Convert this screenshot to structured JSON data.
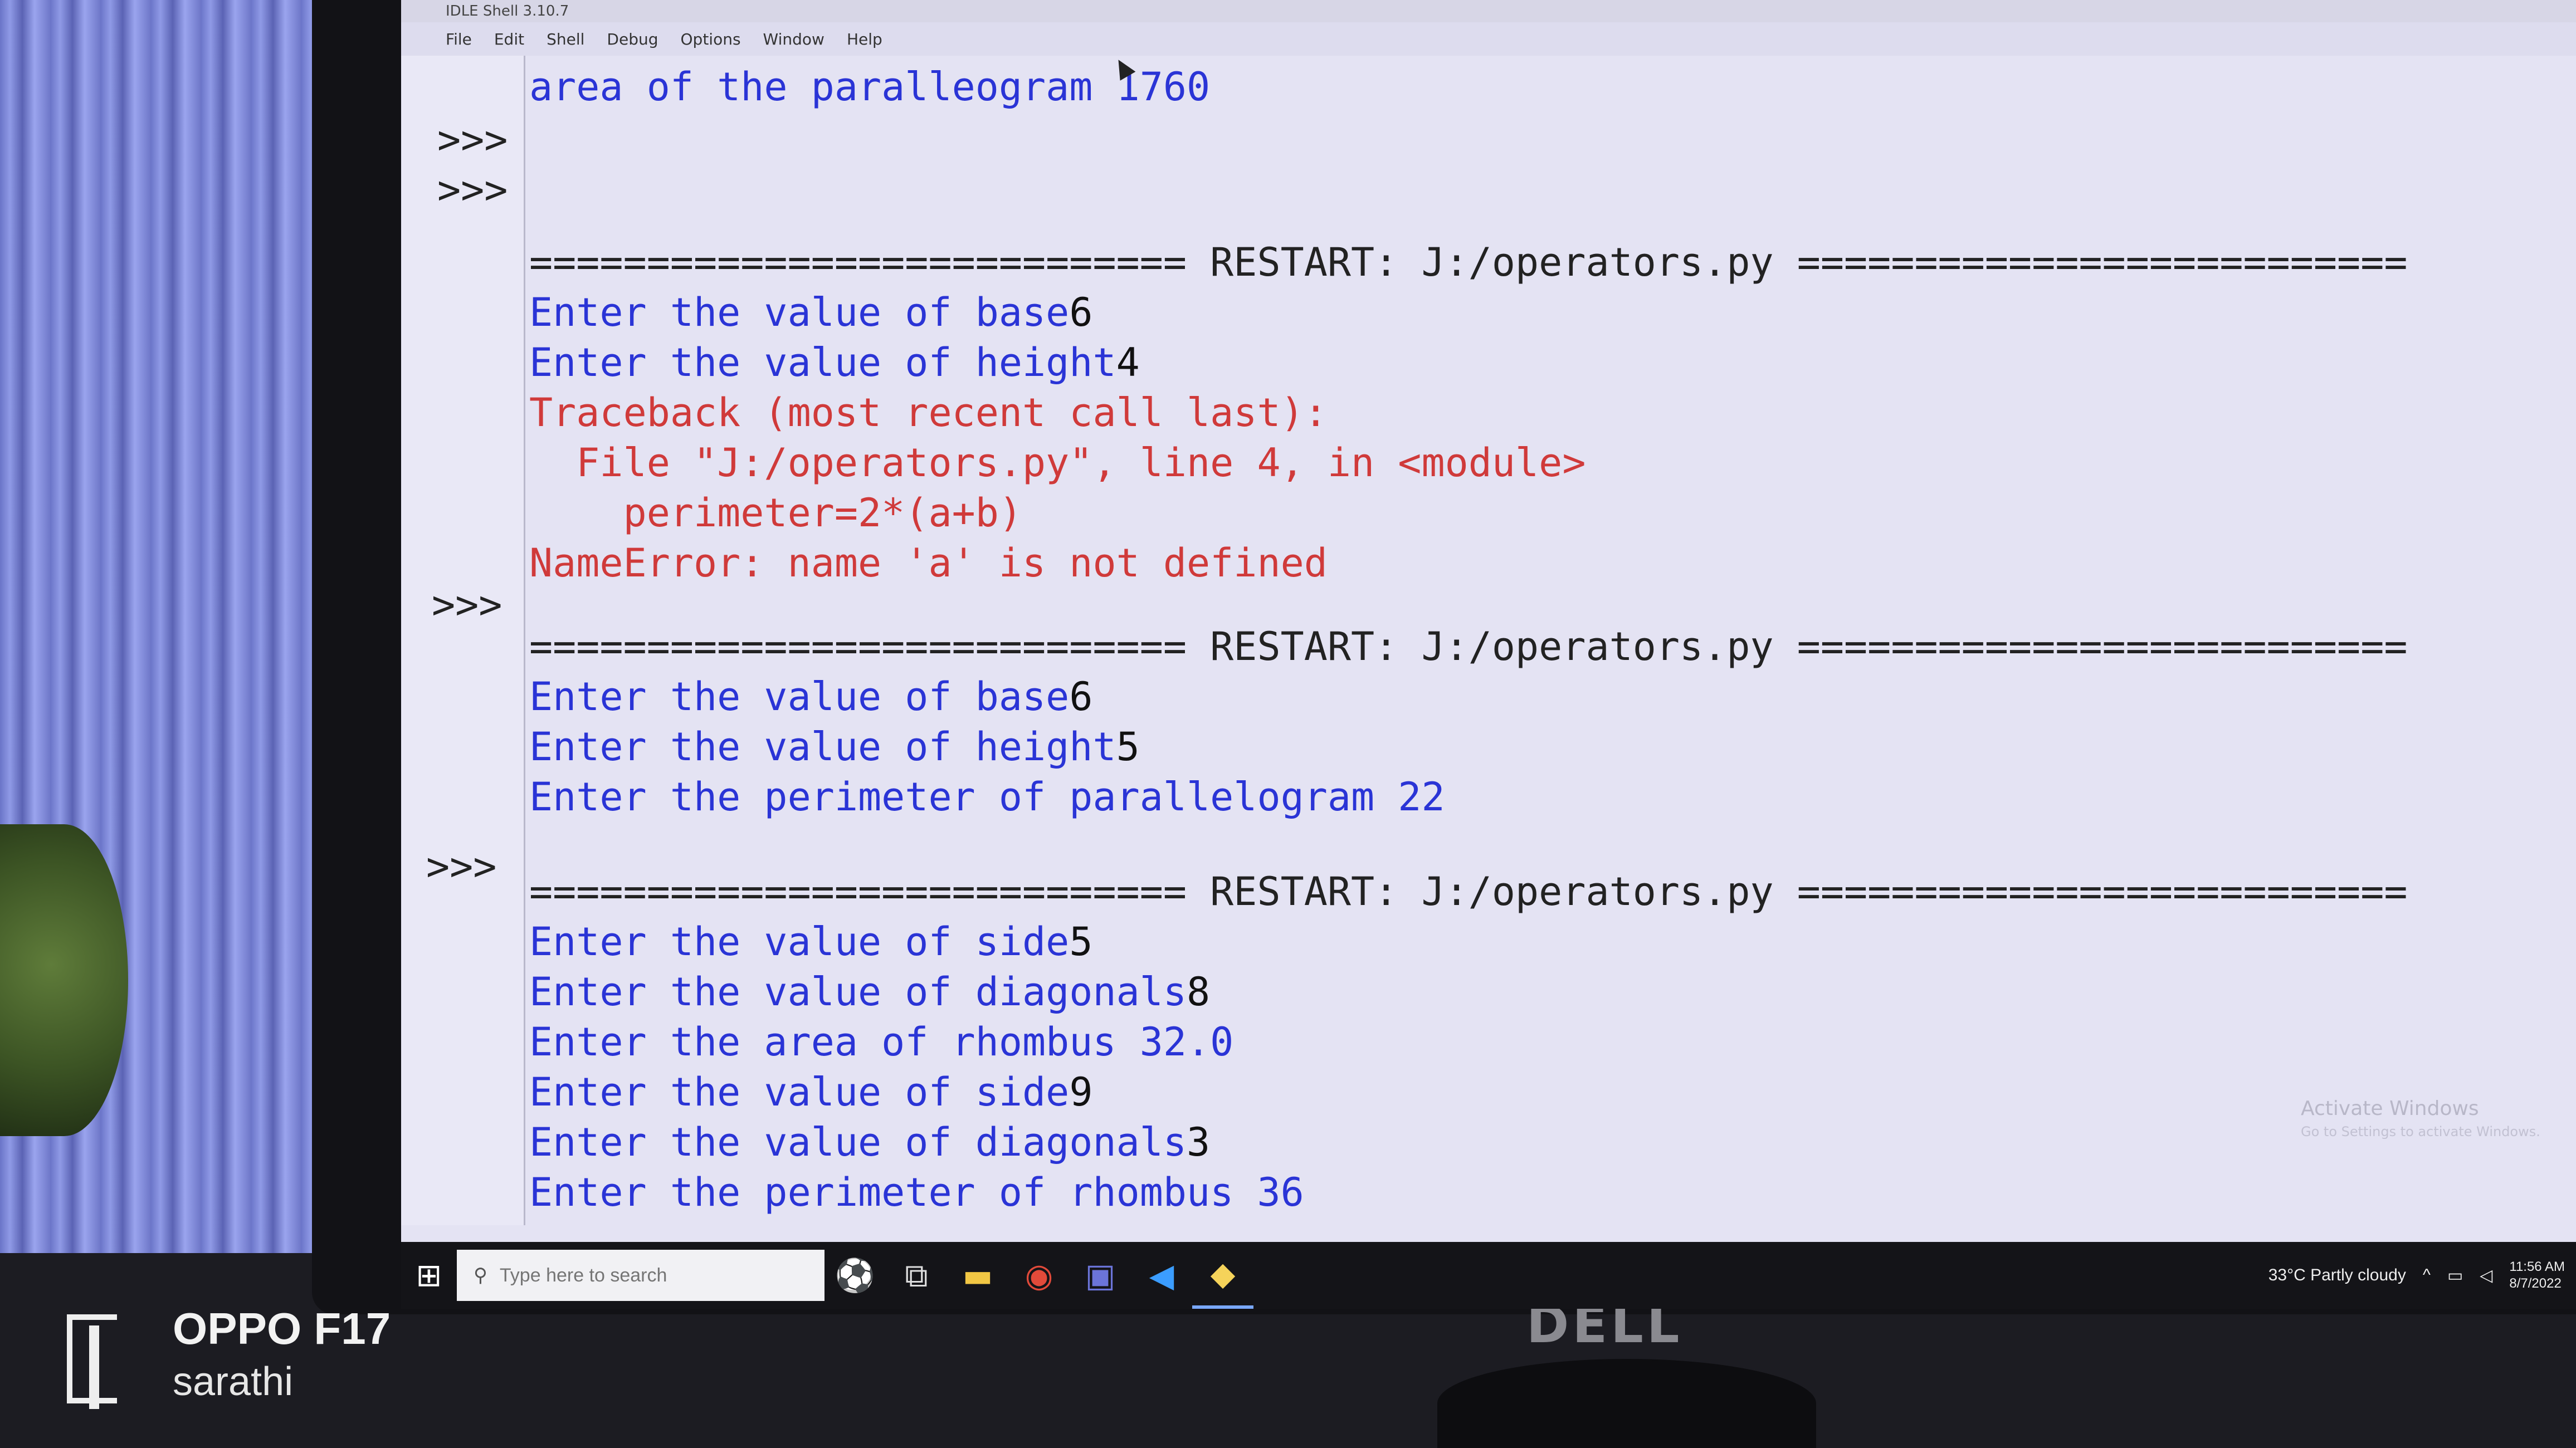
{
  "window": {
    "title": "IDLE Shell 3.10.7",
    "menu": [
      "File",
      "Edit",
      "Shell",
      "Debug",
      "Options",
      "Window",
      "Help"
    ]
  },
  "shell": {
    "lines": [
      {
        "text": "area of the paralleogram 1760",
        "kind": "out"
      },
      {
        "text": "============================ RESTART: J:/operators.py ==========================",
        "kind": "sep"
      },
      {
        "text": "Enter the value of base",
        "input": "6",
        "kind": "out"
      },
      {
        "text": "Enter the value of height",
        "input": "4",
        "kind": "out"
      },
      {
        "text": "Traceback (most recent call last):",
        "kind": "err"
      },
      {
        "text": "  File \"J:/operators.py\", line 4, in <module>",
        "kind": "err"
      },
      {
        "text": "    perimeter=2*(a+b)",
        "kind": "err"
      },
      {
        "text": "NameError: name 'a' is not defined",
        "kind": "err"
      },
      {
        "text": "============================ RESTART: J:/operators.py ==========================",
        "kind": "sep"
      },
      {
        "text": "Enter the value of base",
        "input": "6",
        "kind": "out"
      },
      {
        "text": "Enter the value of height",
        "input": "5",
        "kind": "out"
      },
      {
        "text": "Enter the perimeter of parallelogram 22",
        "kind": "out"
      },
      {
        "text": "============================ RESTART: J:/operators.py ==========================",
        "kind": "sep"
      },
      {
        "text": "Enter the value of side",
        "input": "5",
        "kind": "out"
      },
      {
        "text": "Enter the value of diagonals",
        "input": "8",
        "kind": "out"
      },
      {
        "text": "Enter the area of rhombus 32.0",
        "kind": "out"
      },
      {
        "text": "Enter the value of side",
        "input": "9",
        "kind": "out"
      },
      {
        "text": "Enter the value of diagonals",
        "input": "3",
        "kind": "out"
      },
      {
        "text": "Enter the perimeter of rhombus 36",
        "kind": "out"
      }
    ],
    "prompt": ">>>"
  },
  "watermark": {
    "title": "Activate Windows",
    "subtitle": "Go to Settings to activate Windows."
  },
  "taskbar": {
    "search_placeholder": "Type here to search",
    "weather": "33°C  Partly cloudy",
    "time": "11:56 AM",
    "date": "8/7/2022"
  },
  "photo": {
    "monitor_brand": "DELL",
    "camera_model": "OPPO F17",
    "camera_user": "sarathi"
  }
}
